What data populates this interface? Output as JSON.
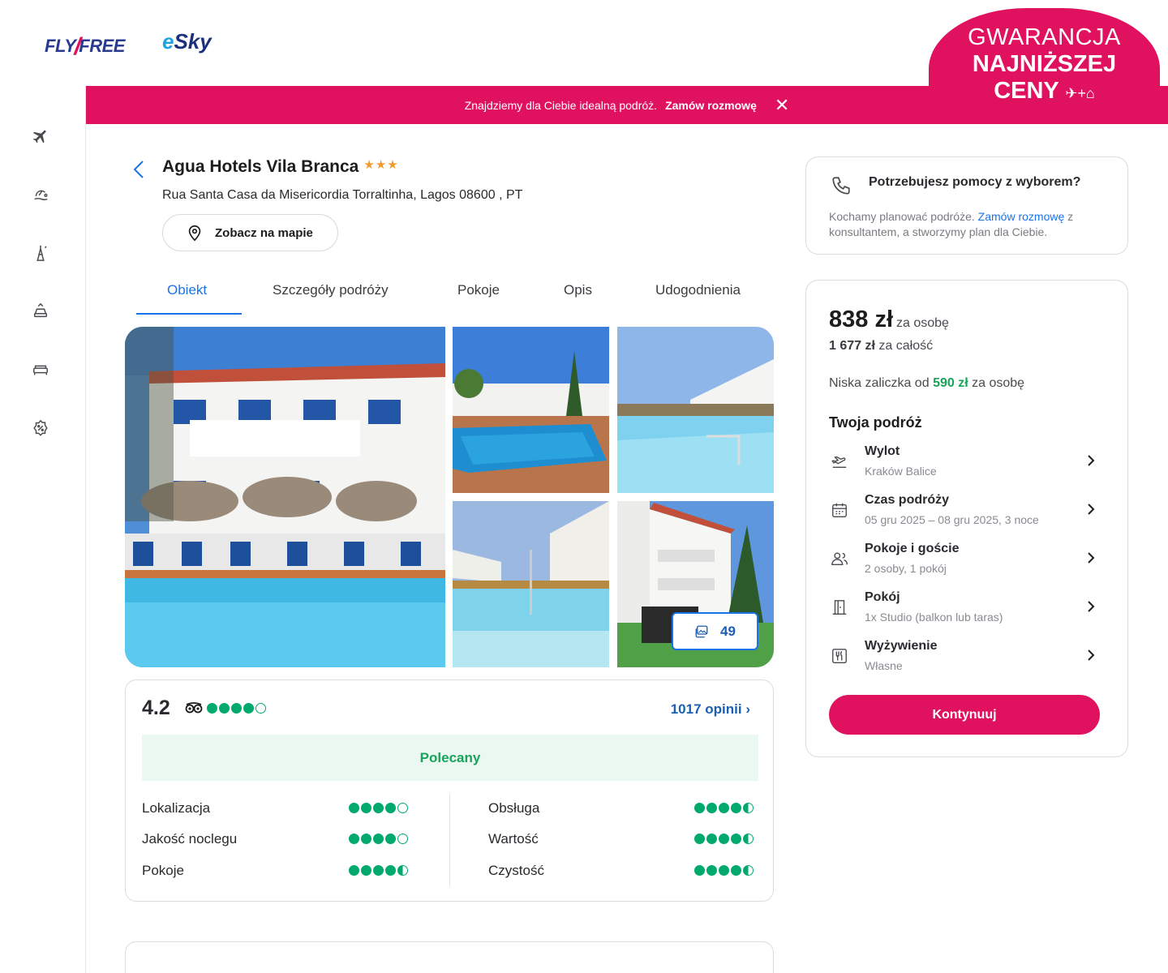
{
  "header": {
    "logo_fly_left": "FLY",
    "logo_fly_right": "FREE",
    "logo_esky_e": "e",
    "logo_esky_rest": "Sky",
    "guarantee_line1": "GWARANCJA",
    "guarantee_line2": "NAJNIŻSZEJ",
    "guarantee_line3": "CENY",
    "guarantee_suffix": "✈+⌂"
  },
  "banner": {
    "text": "Znajdziemy dla Ciebie idealną podróż.",
    "link": "Zamów rozmowę",
    "close": "✕"
  },
  "sidebar": {
    "items": [
      "flight-icon",
      "beach-icon",
      "city-break-icon",
      "car-icon",
      "hotel-icon",
      "discount-icon"
    ]
  },
  "hotel": {
    "name": "Agua Hotels Vila Branca",
    "stars": "★★★",
    "address": "Rua Santa Casa da Misericordia Torraltinha, Lagos 08600 , PT",
    "map_button": "Zobacz na mapie"
  },
  "tabs": [
    "Obiekt",
    "Szczegóły podróży",
    "Pokoje",
    "Opis",
    "Udogodnienia"
  ],
  "gallery": {
    "photo_count": "49"
  },
  "reviews": {
    "rating": "4.2",
    "rating_value": 4.2,
    "opinions": "1017 opinii",
    "verdict": "Polecany",
    "criteria_left": [
      {
        "label": "Lokalizacja",
        "score": 4.0
      },
      {
        "label": "Jakość noclegu",
        "score": 4.0
      },
      {
        "label": "Pokoje",
        "score": 4.5
      }
    ],
    "criteria_right": [
      {
        "label": "Obsługa",
        "score": 4.5
      },
      {
        "label": "Wartość",
        "score": 4.5
      },
      {
        "label": "Czystość",
        "score": 4.5
      }
    ]
  },
  "help": {
    "title": "Potrzebujesz pomocy z wyborem?",
    "text_before": "Kochamy planować podróże.",
    "link": "Zamów rozmowę",
    "text_after": "z konsultantem, a stworzymy plan dla Ciebie."
  },
  "price": {
    "per_person": "838 zł",
    "per_person_label": "za osobę",
    "total": "1 677 zł",
    "total_label": "za całość",
    "deposit_prefix": "Niska zaliczka od",
    "deposit_amount": "590 zł",
    "deposit_suffix": "za osobę",
    "trip_title": "Twoja podróż",
    "rows": [
      {
        "label": "Wylot",
        "value": "Kraków Balice",
        "icon": "departure-icon"
      },
      {
        "label": "Czas podróży",
        "value": "05 gru 2025 – 08 gru 2025, 3 noce",
        "icon": "calendar-icon"
      },
      {
        "label": "Pokoje i goście",
        "value": "2 osoby, 1 pokój",
        "icon": "guests-icon"
      },
      {
        "label": "Pokój",
        "value": "1x Studio (balkon lub taras)",
        "icon": "door-icon"
      },
      {
        "label": "Wyżywienie",
        "value": "Własne",
        "icon": "meal-icon"
      }
    ],
    "cta": "Kontynuuj"
  },
  "colors": {
    "brand": "#e0115f",
    "link": "#1a73e8",
    "rating_green": "#00aa6c",
    "deposit_green": "#1aa35c"
  }
}
